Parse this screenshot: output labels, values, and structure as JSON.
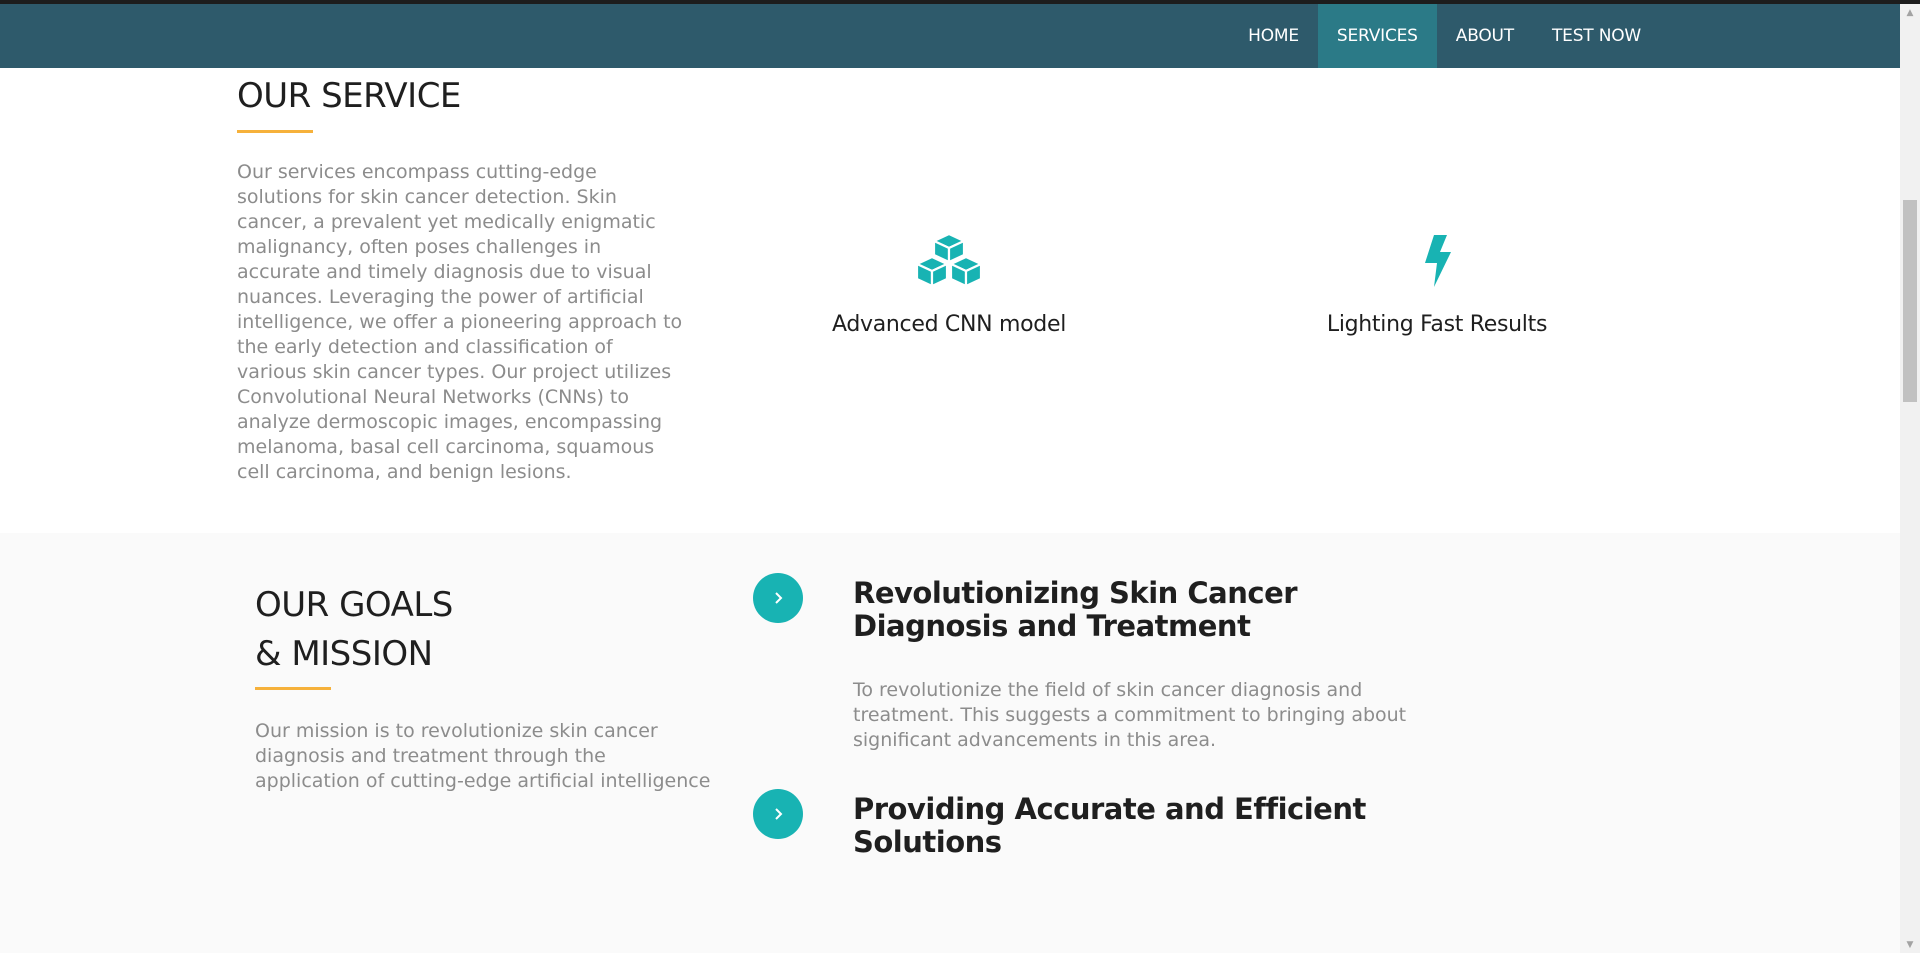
{
  "nav": {
    "items": [
      {
        "label": "HOME"
      },
      {
        "label": "SERVICES"
      },
      {
        "label": "ABOUT"
      },
      {
        "label": "TEST NOW"
      }
    ]
  },
  "service": {
    "title": "OUR SERVICE",
    "description": "Our services encompass cutting-edge solutions for skin cancer detection. Skin cancer, a prevalent yet medically enigmatic malignancy, often poses challenges in accurate and timely diagnosis due to visual nuances. Leveraging the power of artificial intelligence, we offer a pioneering approach to the early detection and classification of various skin cancer types. Our project utilizes Convolutional Neural Networks (CNNs) to analyze dermoscopic images, encompassing melanoma, basal cell carcinoma, squamous cell carcinoma, and benign lesions.",
    "features": [
      {
        "icon": "cubes-icon",
        "label": "Advanced CNN model"
      },
      {
        "icon": "bolt-icon",
        "label": "Lighting Fast Results"
      }
    ]
  },
  "goals": {
    "title_line1": "OUR GOALS",
    "title_line2": "& MISSION",
    "description": "Our mission is to revolutionize skin cancer diagnosis and treatment through the application of cutting-edge artificial intelligence",
    "items": [
      {
        "heading": "Revolutionizing Skin Cancer Diagnosis and Treatment",
        "text": "To revolutionize the field of skin cancer diagnosis and treatment. This suggests a commitment to bringing about significant advancements in this area."
      },
      {
        "heading": "Providing Accurate and Efficient Solutions",
        "text": ""
      }
    ]
  },
  "colors": {
    "navbar": "#2e5a6b",
    "nav_active": "#2b7a87",
    "accent": "#18b3b3",
    "underline": "#f6b13b"
  }
}
